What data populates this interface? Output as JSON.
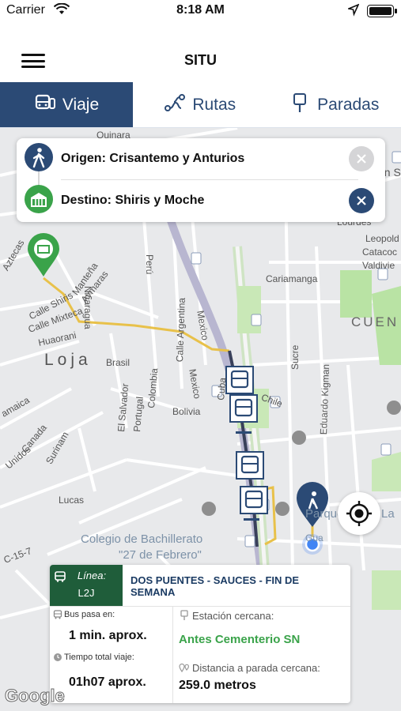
{
  "status_bar": {
    "carrier": "Carrier",
    "time": "8:18 AM"
  },
  "header": {
    "title": "SITU"
  },
  "tabs": [
    {
      "label": "Viaje",
      "icon": "bus-icon",
      "active": true
    },
    {
      "label": "Rutas",
      "icon": "route-icon",
      "active": false
    },
    {
      "label": "Paradas",
      "icon": "bus-stop-icon",
      "active": false
    }
  ],
  "trip": {
    "origin": "Origen: Crisantemo y Anturios",
    "destination": "Destino: Shiris y Moche"
  },
  "map": {
    "labels": {
      "quinara": "Quinara",
      "san": "an S",
      "lourdes": "Lourdes",
      "leopoldo": "Leopold",
      "catacocha": "Catacoc",
      "valdivieso": "Valdivie",
      "cariamanga": "Cariamanga",
      "cuenca": "CUEN",
      "loja": "Loja",
      "aztecas": "Aztecas",
      "shiris": "Calle Shiris",
      "mixteca": "Calle Mixteca",
      "huaorani": "Huaorani",
      "manteña": "Manteña",
      "aymaras": "Aymaras",
      "nicaragua": "Nicaragua",
      "peru": "Perú",
      "argentina": "Calle Argentina",
      "mexico1": "Mexico",
      "mexico2": "Mexico",
      "brasil": "Brasil",
      "elsalvador": "El Salvador",
      "portugal": "Portugal",
      "colombia": "Colombia",
      "bolivia": "Bolivia",
      "cuba": "Cuba",
      "chile": "Chile",
      "sucre": "Sucre",
      "kigman": "Eduardo Kigman",
      "jamaica": "amaica",
      "canada": "Canada",
      "surinam": "Surinam",
      "unidos": "Unidos",
      "lucas": "Lucas",
      "colegio1": "Colegio de Bachillerato",
      "colegio2": "\"27 de Febrero\"",
      "c157": "C-15-7",
      "la": "La",
      "parque": "Parque",
      "guate": "Gua"
    }
  },
  "route_card": {
    "line_label": "Línea:",
    "line_value": "L2J",
    "route_name": "DOS PUENTES - SAUCES - FIN DE SEMANA",
    "bus_label": "Bus pasa en:",
    "bus_value": "1 min. aprox.",
    "total_label": "Tiempo total viaje:",
    "total_value": "01h07 aprox.",
    "station_label": "Estación cercana:",
    "station_value": "Antes Cementerio SN",
    "distance_label": "Distancia a parada cercana:",
    "distance_value": "259.0 metros"
  },
  "attribution": "Google",
  "colors": {
    "primary": "#2b4a75",
    "green": "#3aa34a",
    "route": "#e8c14a",
    "line_bg": "#1f5d3a"
  }
}
